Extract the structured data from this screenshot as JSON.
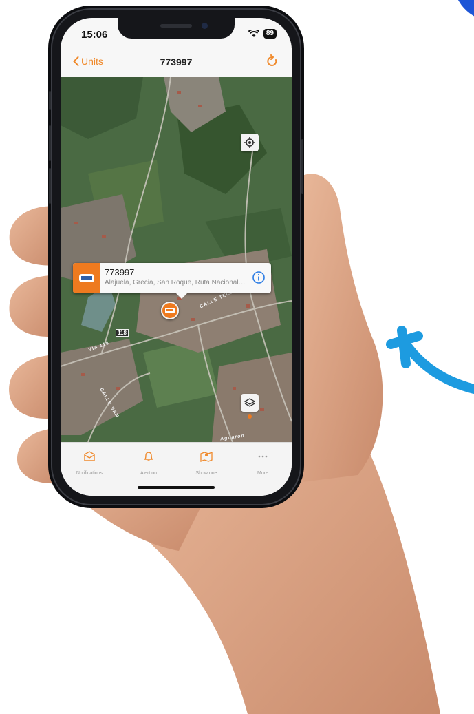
{
  "status_bar": {
    "time": "15:06",
    "battery": "89"
  },
  "nav": {
    "back_label": "Units",
    "title": "773997"
  },
  "map": {
    "popup": {
      "title": "773997",
      "address": "Alajuela, Grecia, San Roque, Ruta Nacional 1..."
    },
    "road_badge": "118",
    "street_labels": [
      "VIA 118",
      "CALLE SAN",
      "CALLE TECHO",
      "Aguaron"
    ]
  },
  "tabs": [
    {
      "label": "Notifications",
      "icon": "envelope-icon"
    },
    {
      "label": "Alert on",
      "icon": "bell-icon"
    },
    {
      "label": "Show one",
      "icon": "map-pin-icon"
    },
    {
      "label": "More",
      "icon": "more-dots-icon"
    }
  ],
  "colors": {
    "accent": "#ee7a1f",
    "info_blue": "#2a7be4",
    "deco_blue": "#1d9be0"
  }
}
